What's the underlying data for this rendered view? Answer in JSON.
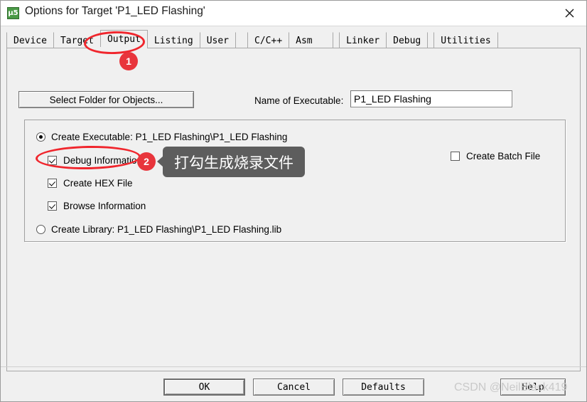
{
  "window": {
    "title": "Options for Target 'P1_LED Flashing'",
    "icon_name": "keil-uvision-icon",
    "icon_glyph": "μ5",
    "close_label": "close-icon"
  },
  "tabs": [
    {
      "label": "Device",
      "selected": false
    },
    {
      "label": "Target",
      "selected": false
    },
    {
      "label": "Output",
      "selected": true
    },
    {
      "label": "Listing",
      "selected": false
    },
    {
      "label": "User",
      "selected": false
    },
    {
      "label": "C/C++",
      "selected": false
    },
    {
      "label": "Asm",
      "selected": false
    },
    {
      "label": "Linker",
      "selected": false
    },
    {
      "label": "Debug",
      "selected": false
    },
    {
      "label": "Utilities",
      "selected": false
    }
  ],
  "output_page": {
    "select_folder_button": "Select Folder for Objects...",
    "executable_name_label": "Name of Executable:",
    "executable_name_value": "P1_LED Flashing",
    "executable_name_placeholder": "",
    "create_executable": {
      "label": "Create Executable:  P1_LED Flashing\\P1_LED Flashing",
      "selected": true
    },
    "debug_information": {
      "label": "Debug Information",
      "checked": true
    },
    "create_hex_file": {
      "label": "Create HEX File",
      "checked": true
    },
    "browse_information": {
      "label": "Browse Information",
      "checked": true
    },
    "create_batch_file": {
      "label": "Create Batch File",
      "checked": false
    },
    "create_library": {
      "label": "Create Library:  P1_LED Flashing\\P1_LED Flashing.lib",
      "selected": false
    }
  },
  "footer": {
    "ok": "OK",
    "cancel": "Cancel",
    "defaults": "Defaults",
    "help": "Help",
    "watermark": "CSDN @NeilBlack419"
  },
  "annotations": {
    "badge_1": "1",
    "badge_2": "2",
    "callout_text": "打勾生成烧录文件",
    "accent_color": "#e8353c",
    "ellipse_color": "#f0262d",
    "callout_bg": "#5d5d5d"
  }
}
